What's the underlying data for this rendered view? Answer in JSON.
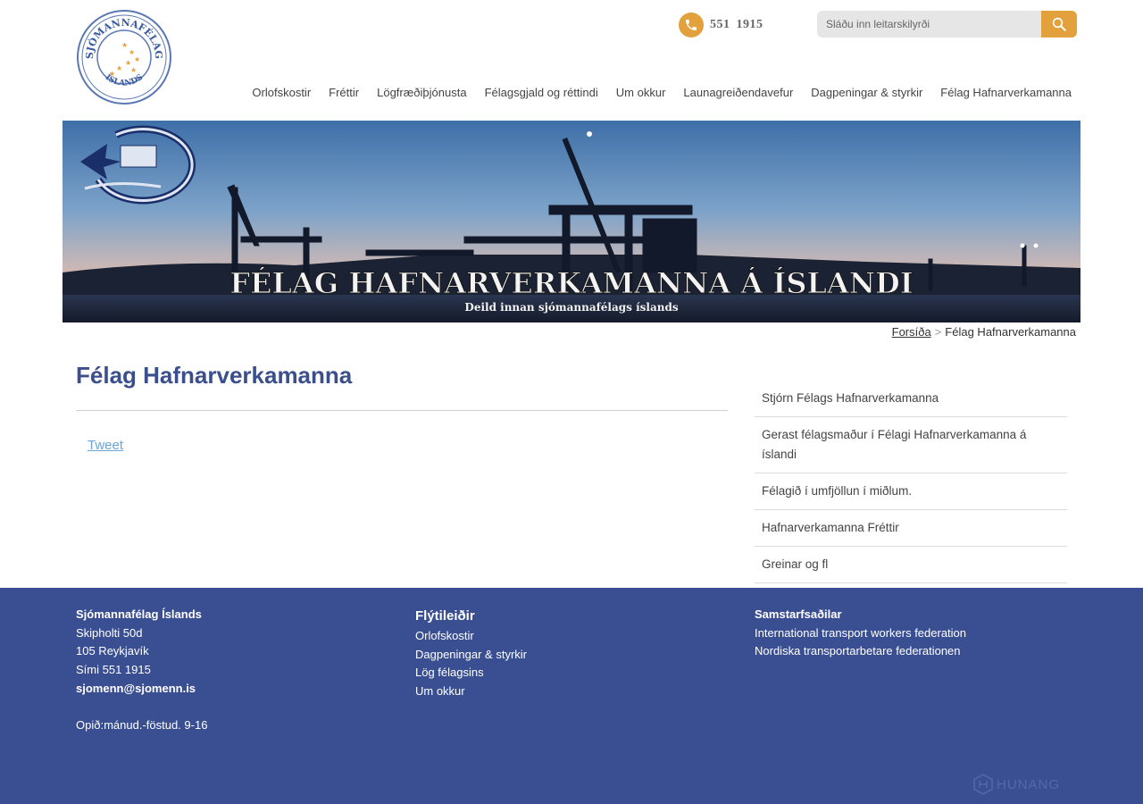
{
  "header": {
    "logo_text_top": "SJÓMANNAFÉLAG",
    "logo_text_bottom": "ÍSLANDS",
    "phone": "551  1915",
    "search_placeholder": "Sláðu inn leitarskilyrði"
  },
  "nav": {
    "items": [
      {
        "label": "Orlofskostir"
      },
      {
        "label": "Fréttir"
      },
      {
        "label": "Lögfræðiþjónusta"
      },
      {
        "label": "Félagsgjald og réttindi"
      },
      {
        "label": "Um okkur"
      },
      {
        "label": "Launagreiðendavefur"
      },
      {
        "label": "Dagpeningar & styrkir"
      },
      {
        "label": "Félag Hafnarverkamanna"
      }
    ]
  },
  "banner": {
    "title": "FÉLAG HAFNARVERKAMANNA Á ÍSLANDI",
    "subtitle": "Deild innan sjómannafélags íslands"
  },
  "breadcrumb": {
    "home": "Forsíða",
    "separator": ">",
    "current": "Félag Hafnarverkamanna"
  },
  "page": {
    "title": "Félag Hafnarverkamanna",
    "tweet": "Tweet"
  },
  "sidebar": {
    "items": [
      {
        "label": "Stjórn Félags Hafnarverkamanna"
      },
      {
        "label": "Gerast félagsmaður í Félagi Hafnarverkamanna á íslandi"
      },
      {
        "label": "Félagið í umfjöllun í miðlum."
      },
      {
        "label": "Hafnarverkamanna Fréttir"
      },
      {
        "label": "Greinar og fl"
      }
    ]
  },
  "footer": {
    "org": "Sjómannafélag Íslands",
    "address1": "Skipholti 50d",
    "address2": "105 Reykjavík",
    "phone": "Sími 551 1915",
    "email": "sjomenn@sjomenn.is",
    "hours": "Opið:mánud.-föstud. 9-16",
    "quick_heading": "Flýtileiðir",
    "quick_links": [
      {
        "label": "Orlofskostir"
      },
      {
        "label": "Dagpeningar & styrkir"
      },
      {
        "label": "Lög félagsins"
      },
      {
        "label": "Um okkur"
      }
    ],
    "partners_heading": "Samstarfsaðilar",
    "partners": [
      {
        "label": "International transport workers federation"
      },
      {
        "label": "Nordiska transportarbetare federationen"
      }
    ],
    "credit": "HUNANG"
  },
  "colors": {
    "accent": "#e2a13c",
    "title_blue": "#3a4f8c",
    "footer_bg": "#3a4f92",
    "link_blue": "#6aa4d8"
  }
}
